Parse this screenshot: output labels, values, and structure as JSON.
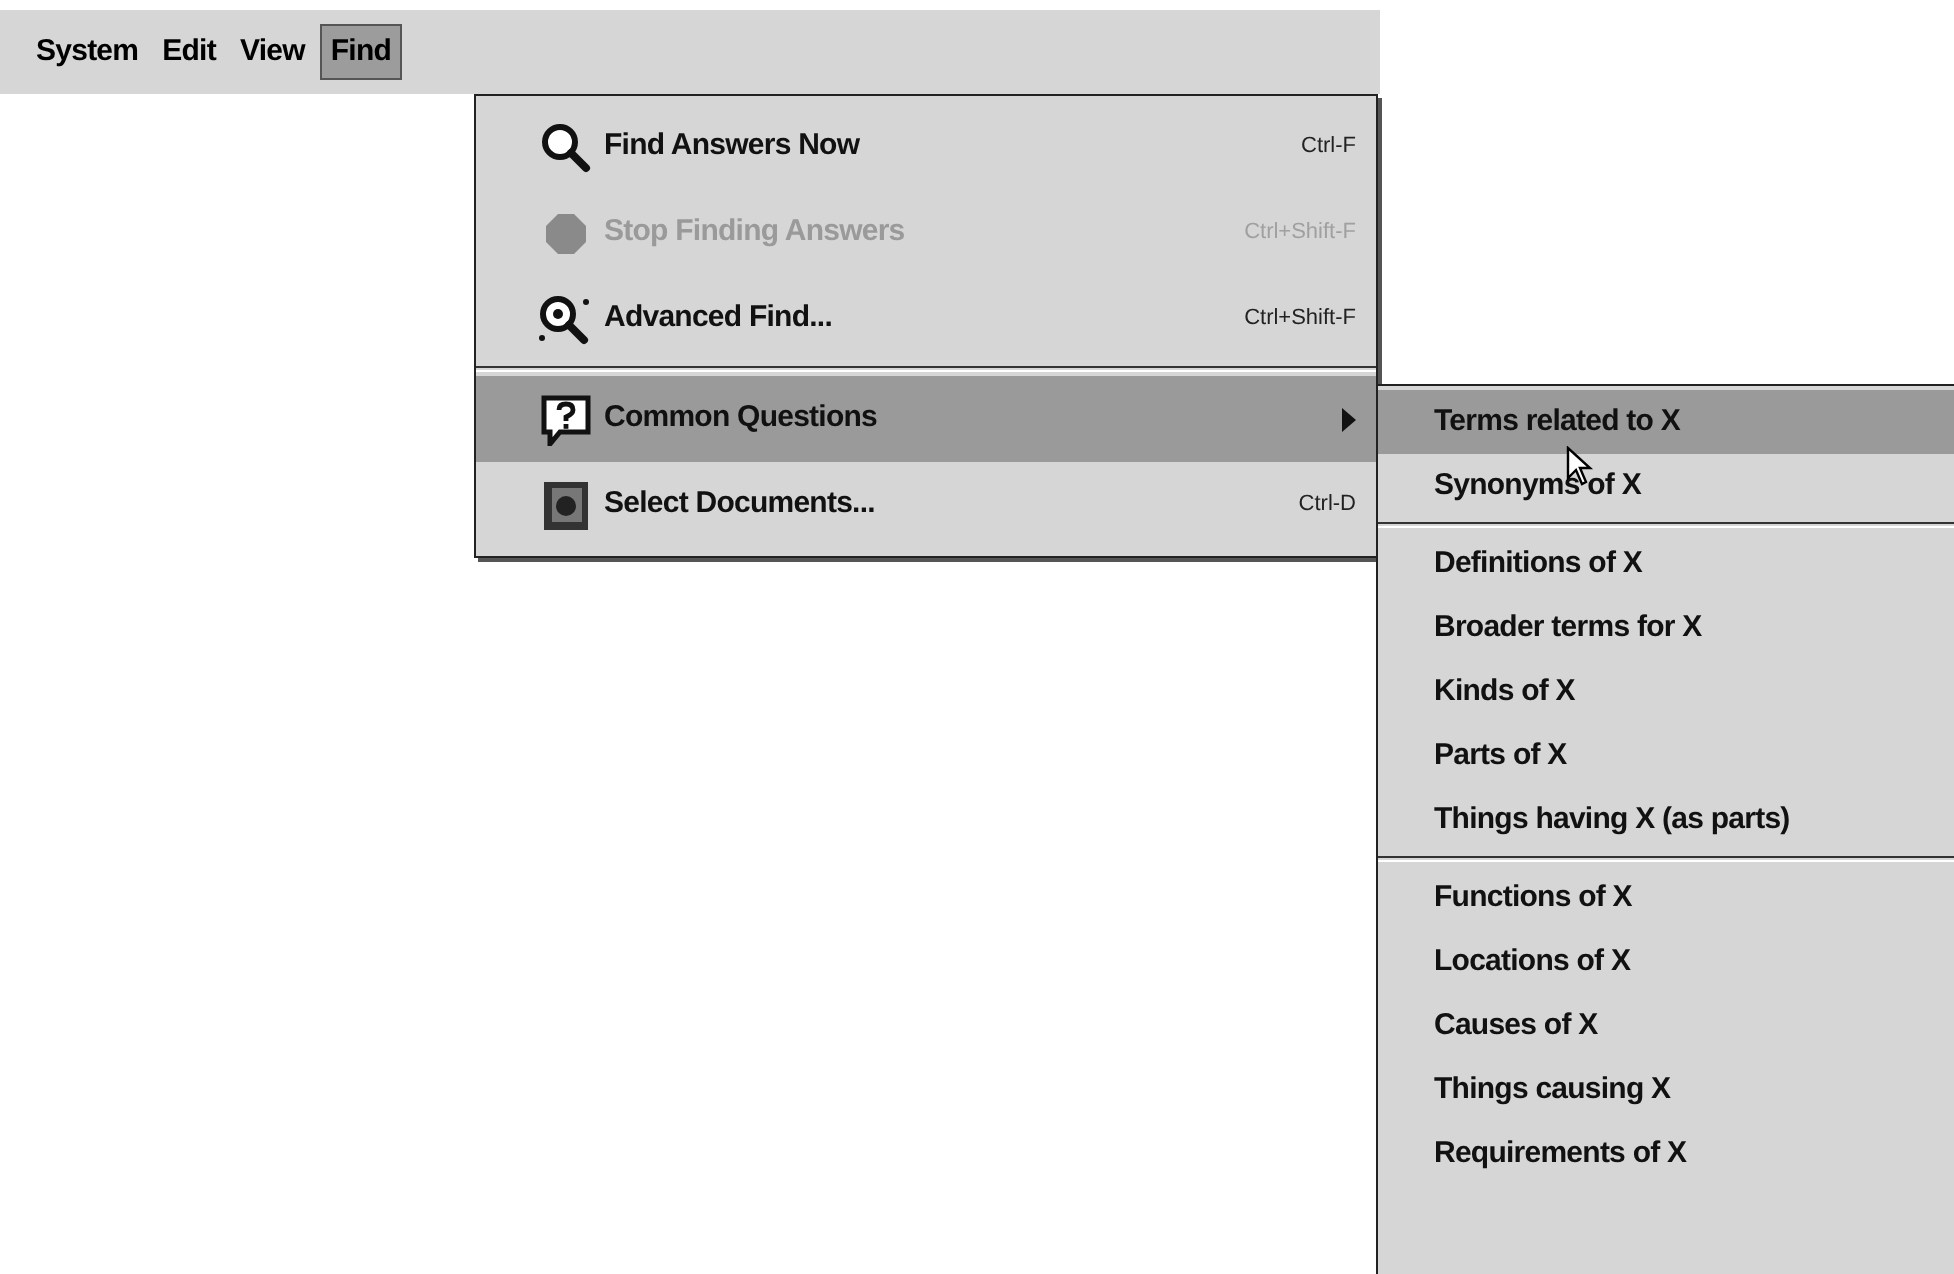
{
  "menubar": [
    {
      "label": "System",
      "selected": false
    },
    {
      "label": "Edit",
      "selected": false
    },
    {
      "label": "View",
      "selected": false
    },
    {
      "label": "Find",
      "selected": true
    }
  ],
  "find_menu": [
    {
      "kind": "item",
      "label": "Find Answers Now",
      "shortcut": "Ctrl-F",
      "disabled": false,
      "selected": false,
      "submenu": false
    },
    {
      "kind": "item",
      "label": "Stop Finding Answers",
      "shortcut": "Ctrl+Shift-F",
      "disabled": true,
      "selected": false,
      "submenu": false
    },
    {
      "kind": "item",
      "label": "Advanced Find...",
      "shortcut": "Ctrl+Shift-F",
      "disabled": false,
      "selected": false,
      "submenu": false
    },
    {
      "kind": "separator"
    },
    {
      "kind": "item",
      "label": "Common Questions",
      "disabled": false,
      "selected": true,
      "submenu": true
    },
    {
      "kind": "item",
      "label": "Select Documents...",
      "shortcut": "Ctrl-D",
      "disabled": false,
      "selected": false,
      "submenu": false
    }
  ],
  "submenu": [
    {
      "kind": "item",
      "label": "Terms related to X",
      "selected": true
    },
    {
      "kind": "item",
      "label": "Synonyms of X",
      "selected": false
    },
    {
      "kind": "separator"
    },
    {
      "kind": "item",
      "label": "Definitions of X",
      "selected": false
    },
    {
      "kind": "item",
      "label": "Broader terms for X",
      "selected": false
    },
    {
      "kind": "item",
      "label": "Kinds of X",
      "selected": false
    },
    {
      "kind": "item",
      "label": "Parts of X",
      "selected": false
    },
    {
      "kind": "item",
      "label": "Things having X (as parts)",
      "selected": false
    },
    {
      "kind": "separator"
    },
    {
      "kind": "item",
      "label": "Functions of X",
      "selected": false
    },
    {
      "kind": "item",
      "label": "Locations of X",
      "selected": false
    },
    {
      "kind": "item",
      "label": "Causes of X",
      "selected": false
    },
    {
      "kind": "item",
      "label": "Things causing X",
      "selected": false
    },
    {
      "kind": "item",
      "label": "Requirements of X",
      "selected": false
    }
  ]
}
